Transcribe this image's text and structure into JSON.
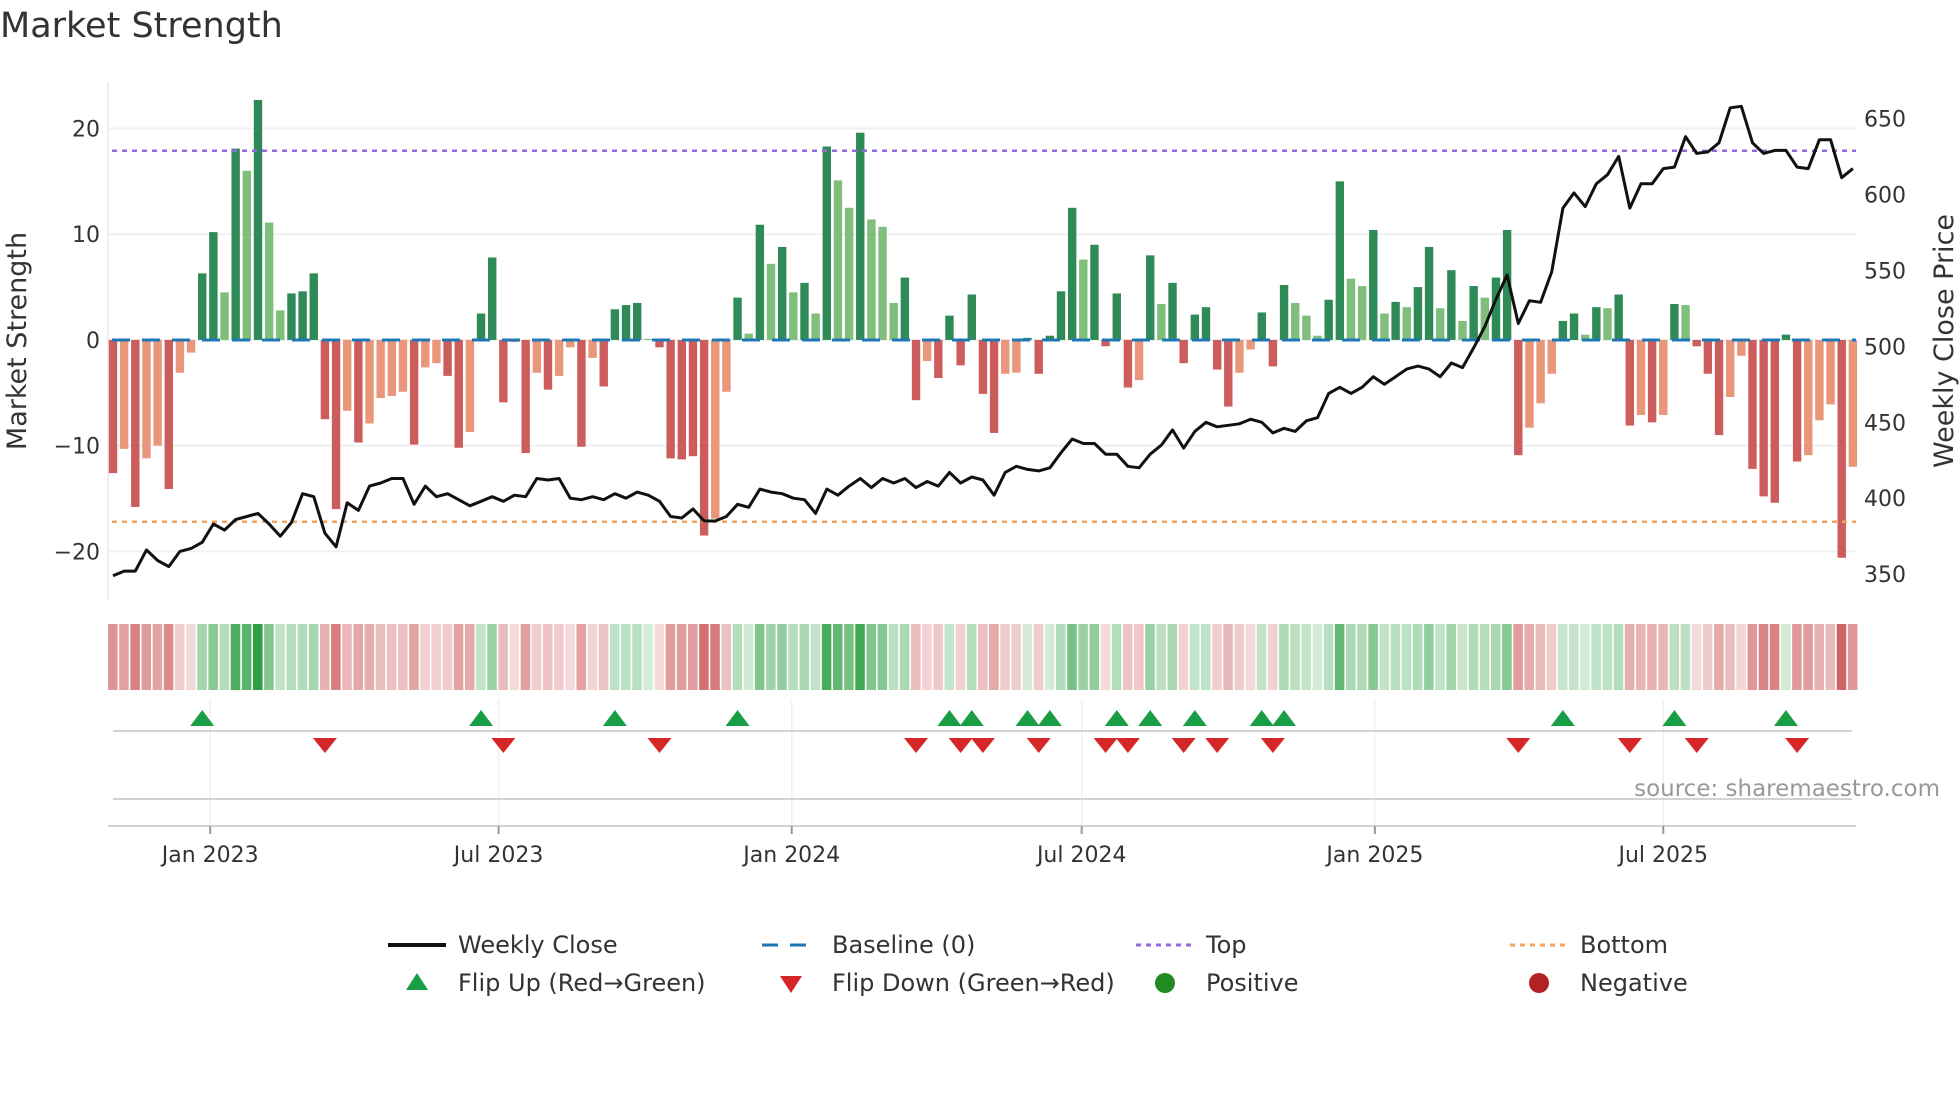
{
  "chart_data": {
    "type": "bar",
    "title": "Market Strength",
    "source_note": "source: sharemaestro.com",
    "x_start_date": "2022-11-01",
    "x_interval": "weekly",
    "x_ticks": [
      {
        "label": "Jan 2023",
        "date": "2023-01-01"
      },
      {
        "label": "Jul 2023",
        "date": "2023-07-01"
      },
      {
        "label": "Jan 2024",
        "date": "2024-01-01"
      },
      {
        "label": "Jul 2024",
        "date": "2024-07-01"
      },
      {
        "label": "Jan 2025",
        "date": "2025-01-01"
      },
      {
        "label": "Jul 2025",
        "date": "2025-07-01"
      }
    ],
    "y_left": {
      "label": "Market Strength",
      "ylim": [
        -24.6,
        24.4
      ],
      "ticks": [
        20,
        10,
        0,
        -10,
        -20
      ],
      "tick_labels": [
        "20",
        "10",
        "0",
        "−10",
        "−20"
      ]
    },
    "y_right": {
      "label": "Weekly Close Price",
      "ylim": [
        333,
        674
      ],
      "ticks": [
        650,
        600,
        550,
        500,
        450,
        400,
        350
      ],
      "tick_labels": [
        "650",
        "600",
        "550",
        "500",
        "450",
        "400",
        "350"
      ]
    },
    "grid": true,
    "top_level": 17.9,
    "bottom_level": -17.2,
    "baseline": 0,
    "strength": [
      -12.6,
      -10.3,
      -15.8,
      -11.2,
      -10.0,
      -14.1,
      -3.1,
      -1.2,
      6.3,
      10.2,
      4.5,
      18.1,
      16.0,
      22.7,
      11.1,
      2.8,
      4.4,
      4.6,
      6.3,
      -7.5,
      -16.0,
      -6.7,
      -9.7,
      -7.9,
      -5.5,
      -5.3,
      -4.9,
      -9.9,
      -2.6,
      -2.2,
      -3.4,
      -10.2,
      -8.7,
      2.5,
      7.8,
      -5.9,
      -0.2,
      -10.7,
      -3.1,
      -4.7,
      -3.4,
      -0.7,
      -10.1,
      -1.7,
      -4.4,
      2.9,
      3.3,
      3.5,
      0.1,
      -0.7,
      -11.2,
      -11.3,
      -11.0,
      -18.5,
      -16.9,
      -4.9,
      4.0,
      0.6,
      10.9,
      7.2,
      8.8,
      4.5,
      5.4,
      2.5,
      18.3,
      15.1,
      12.5,
      19.6,
      11.4,
      10.7,
      3.5,
      5.9,
      -5.7,
      -2.0,
      -3.6,
      2.3,
      -2.4,
      4.3,
      -5.1,
      -8.8,
      -3.2,
      -3.1,
      0.2,
      -3.2,
      0.4,
      4.6,
      12.5,
      7.6,
      9.0,
      -0.6,
      4.4,
      -4.5,
      -3.8,
      8.0,
      3.4,
      5.4,
      -2.2,
      2.4,
      3.1,
      -2.8,
      -6.3,
      -3.1,
      -0.9,
      2.6,
      -2.5,
      5.2,
      3.5,
      2.3,
      0.4,
      3.8,
      15.0,
      5.8,
      5.1,
      10.4,
      2.5,
      3.6,
      3.1,
      5.0,
      8.8,
      3.0,
      6.6,
      1.8,
      5.1,
      4.0,
      5.9,
      10.4,
      -10.9,
      -8.3,
      -6.0,
      -3.2,
      1.8,
      2.5,
      0.5,
      3.1,
      3.0,
      4.3,
      -8.1,
      -7.1,
      -7.8,
      -7.1,
      3.4,
      3.3,
      -0.6,
      -3.2,
      -9.0,
      -5.4,
      -1.5,
      -12.2,
      -14.8,
      -15.4,
      0.5,
      -11.5,
      -10.9,
      -7.6,
      -6.1,
      -20.6,
      -12.0
    ],
    "strength_dark_shade": [
      1,
      0,
      1,
      0,
      0,
      1,
      0,
      0,
      1,
      1,
      0,
      1,
      0,
      1,
      0,
      0,
      1,
      1,
      1,
      1,
      1,
      0,
      1,
      0,
      0,
      0,
      0,
      1,
      0,
      0,
      1,
      1,
      0,
      1,
      1,
      1,
      0,
      1,
      0,
      1,
      0,
      0,
      1,
      0,
      1,
      1,
      1,
      1,
      0,
      1,
      1,
      1,
      1,
      1,
      0,
      0,
      1,
      0,
      1,
      0,
      1,
      0,
      1,
      0,
      1,
      0,
      0,
      1,
      0,
      0,
      0,
      1,
      1,
      0,
      1,
      1,
      1,
      1,
      1,
      1,
      0,
      0,
      1,
      1,
      1,
      1,
      1,
      0,
      1,
      1,
      1,
      1,
      0,
      1,
      0,
      1,
      1,
      1,
      1,
      1,
      1,
      0,
      0,
      1,
      1,
      1,
      0,
      0,
      0,
      1,
      1,
      0,
      0,
      1,
      0,
      1,
      0,
      1,
      1,
      0,
      1,
      0,
      1,
      0,
      1,
      1,
      1,
      0,
      0,
      0,
      1,
      1,
      0,
      1,
      0,
      1,
      1,
      0,
      1,
      0,
      1,
      0,
      1,
      1,
      1,
      0,
      0,
      1,
      1,
      1,
      1,
      1,
      0,
      0,
      0,
      1,
      0
    ],
    "weekly_close": [
      349,
      352,
      352,
      366,
      359,
      355,
      365,
      367,
      371,
      383,
      379,
      386,
      388,
      390,
      383,
      375,
      384,
      403,
      401,
      377,
      368,
      397,
      392,
      408,
      410,
      413,
      413,
      396,
      408,
      401,
      403,
      399,
      395,
      398,
      401,
      398,
      402,
      401,
      413,
      412,
      413,
      400,
      399,
      401,
      399,
      403,
      400,
      404,
      402,
      398,
      388,
      387,
      393,
      385,
      385,
      388,
      396,
      394,
      406,
      404,
      403,
      400,
      399,
      390,
      406,
      402,
      408,
      413,
      407,
      413,
      410,
      413,
      407,
      411,
      408,
      417,
      410,
      414,
      412,
      402,
      417,
      421,
      419,
      418,
      420,
      430,
      439,
      436,
      436,
      429,
      429,
      421,
      420,
      429,
      435,
      445,
      433,
      444,
      450,
      447,
      448,
      449,
      452,
      450,
      443,
      446,
      444,
      451,
      453,
      469,
      473,
      469,
      473,
      480,
      475,
      480,
      485,
      487,
      485,
      480,
      489,
      486,
      499,
      513,
      531,
      547,
      515,
      530,
      529,
      549,
      591,
      601,
      592,
      607,
      613,
      625,
      591,
      607,
      607,
      617,
      618,
      638,
      627,
      628,
      634,
      657,
      658,
      634,
      627,
      629,
      629,
      618,
      617,
      636,
      636,
      611,
      617
    ],
    "legend": {
      "placement": "bottom",
      "items": [
        {
          "label": "Weekly Close",
          "kind": "line"
        },
        {
          "label": "Baseline (0)",
          "kind": "dash"
        },
        {
          "label": "Top",
          "kind": "dot-purple"
        },
        {
          "label": "Bottom",
          "kind": "dot-orange"
        },
        {
          "label": "Flip Up (Red→Green)",
          "kind": "tri-up"
        },
        {
          "label": "Flip Down (Green→Red)",
          "kind": "tri-down"
        },
        {
          "label": "Positive",
          "kind": "circle-green"
        },
        {
          "label": "Negative",
          "kind": "circle-red"
        }
      ]
    },
    "colors": {
      "pos_dark": "#2e8b57",
      "pos_light": "#7fbf7b",
      "neg_dark": "#cd5c5c",
      "neg_light": "#e9967a",
      "price": "#111111",
      "baseline": "#1f77b4",
      "top": "#9467dd",
      "bottom": "#f4a460",
      "flip_up": "#1a9e45",
      "flip_down": "#d62728",
      "positive": "#228b22",
      "negative": "#b22222",
      "heat_pos": "46,160,67",
      "heat_neg": "205,92,92"
    }
  }
}
